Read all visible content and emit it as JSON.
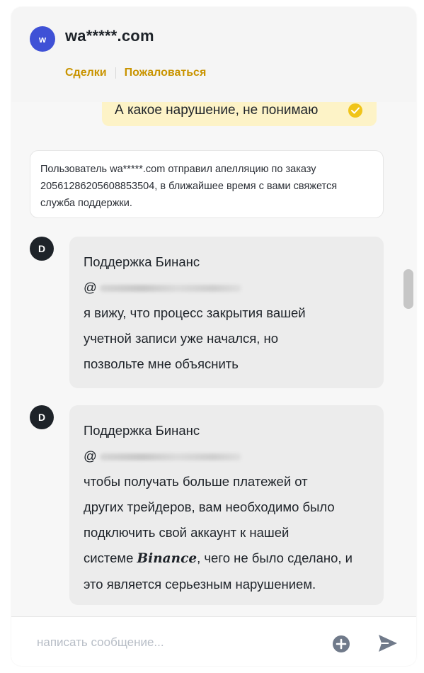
{
  "header": {
    "avatar_letter": "w",
    "title": "wa*****.com",
    "links": {
      "deals": "Сделки",
      "complain": "Пожаловаться"
    }
  },
  "messages": {
    "outgoing": {
      "text": "А какое нарушение, не понимаю",
      "status_icon": "check-circle-icon"
    },
    "system_note": "Пользователь wa*****.com отправил апелляцию по заказу 20561286205608853504, в ближайшее время с вами свяжется служба поддержки.",
    "incoming": [
      {
        "avatar_letter": "D",
        "sender": "Поддержка Бинанс",
        "mention_prefix": "@",
        "lines": [
          "я вижу, что процесс закрытия вашей",
          "учетной записи уже начался, но",
          "позвольте мне объяснить"
        ]
      },
      {
        "avatar_letter": "D",
        "sender": "Поддержка Бинанс",
        "mention_prefix": "@",
        "lines": [
          "чтобы получать больше платежей от",
          "других трейдеров, вам необходимо было",
          "подключить свой аккаунт к нашей"
        ],
        "line4_prefix": "системе ",
        "line4_brand": "Binance",
        "line4_suffix": ", чего не было сделано, и",
        "line5": "это является серьезным нарушением."
      }
    ]
  },
  "input": {
    "placeholder": "написать сообщение...",
    "plus_icon": "plus-circle-icon",
    "send_icon": "send-icon"
  },
  "colors": {
    "accent": "#c99400",
    "outgoing_bubble": "#fdf3c7",
    "incoming_bubble": "#ececec",
    "header_avatar": "#3f51d6",
    "support_avatar": "#1e2329"
  }
}
